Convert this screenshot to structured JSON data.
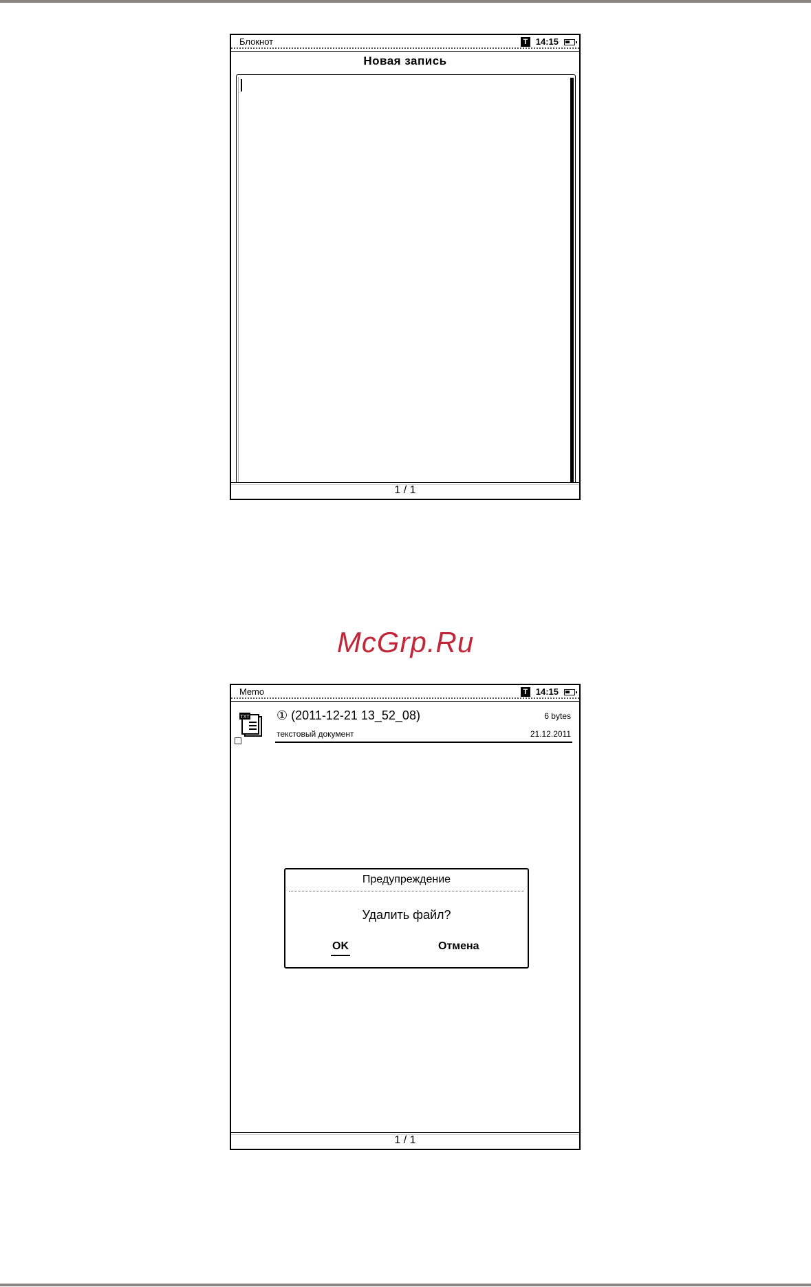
{
  "screen1": {
    "status": {
      "app_title": "Блокнот",
      "t_badge": "T",
      "time": "14:15"
    },
    "heading": "Новая запись",
    "footer": {
      "pagination": "1 / 1"
    }
  },
  "watermark": "McGrp.Ru",
  "screen2": {
    "status": {
      "app_title": "Memo",
      "t_badge": "T",
      "time": "14:15"
    },
    "file": {
      "name": "① (2011-12-21 13_52_08)",
      "size": "6 bytes",
      "type": "текстовый документ",
      "date": "21.12.2011",
      "icon_label": "TXT"
    },
    "dialog": {
      "title": "Предупреждение",
      "message": "Удалить файл?",
      "ok_label": "OK",
      "cancel_label": "Отмена"
    },
    "footer": {
      "pagination": "1 / 1"
    }
  }
}
